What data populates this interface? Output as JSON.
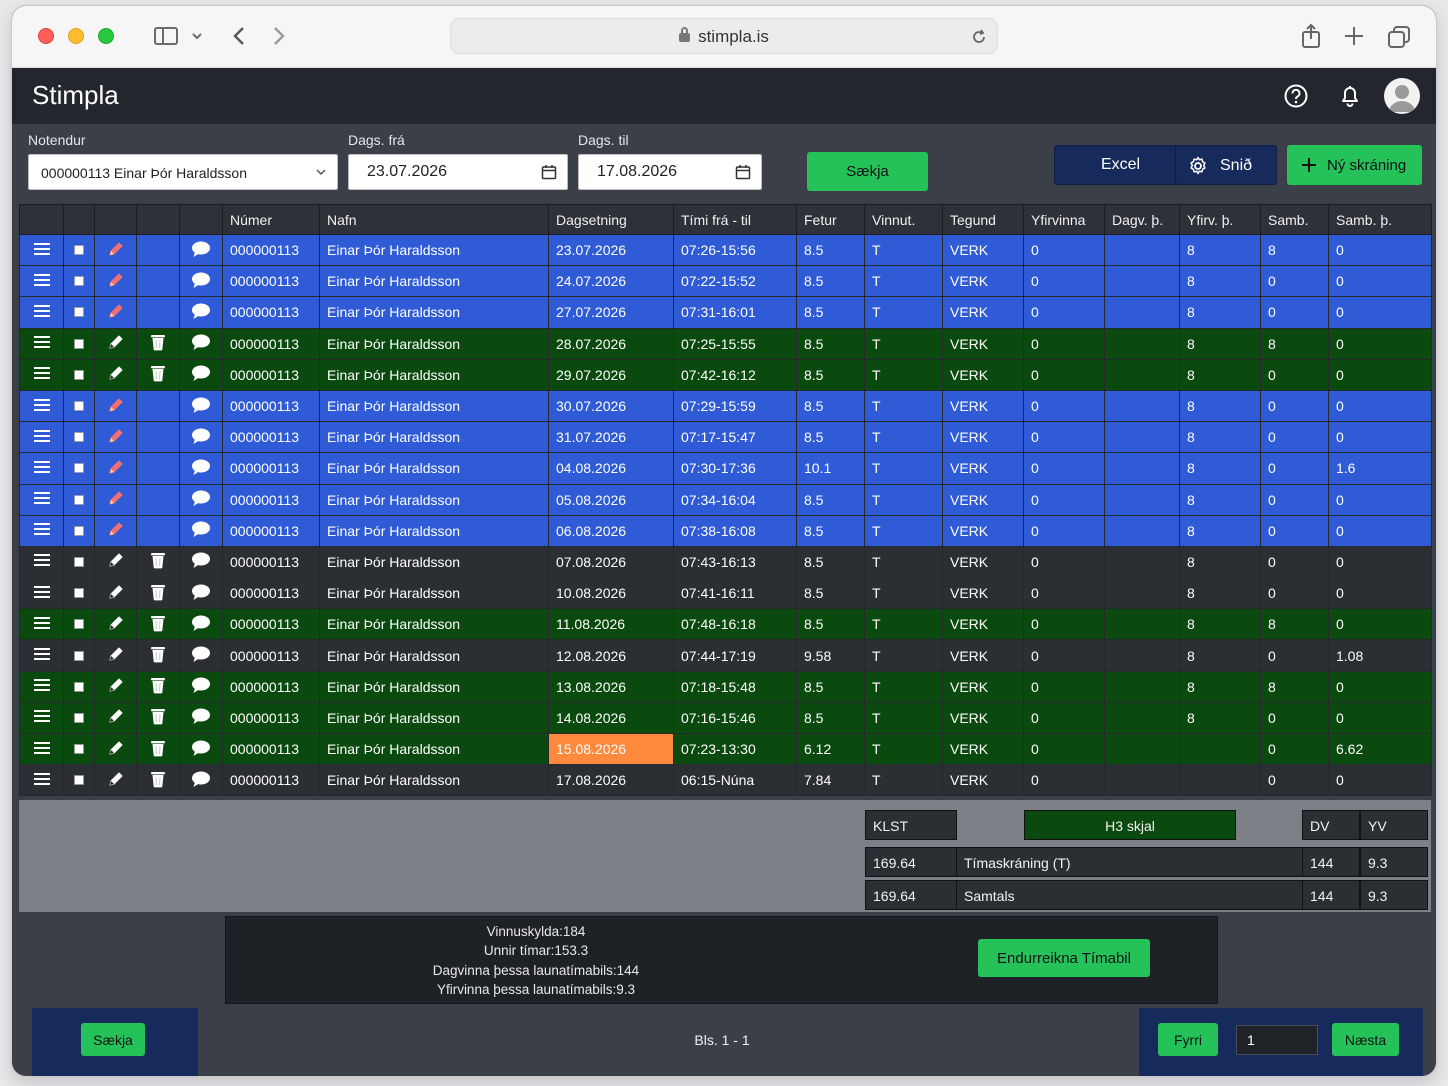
{
  "browser": {
    "url": "stimpla.is"
  },
  "app": {
    "title": "Stimpla"
  },
  "filters": {
    "user_label": "Notendur",
    "user_value": "000000113 Einar Þór Haraldsson",
    "date_from_label": "Dags. frá",
    "date_from": "23.07.2026",
    "date_to_label": "Dags. til",
    "date_to": "17.08.2026",
    "fetch_label": "Sækja",
    "excel_label": "Excel",
    "layout_label": "Snið",
    "new_label": "Ný skráning"
  },
  "table": {
    "columns": [
      "Númer",
      "Nafn",
      "Dagsetning",
      "Tími frá - til",
      "Fetur",
      "Vinnut.",
      "Tegund",
      "Yfirvinna",
      "Dagv. þ.",
      "Yfirv. þ.",
      "Samb.",
      "Samb. þ."
    ],
    "rows": [
      {
        "style": "blue",
        "del": false,
        "num": "000000113",
        "name": "Einar Þór Haraldsson",
        "date": "23.07.2026",
        "time": "07:26-15:56",
        "fetur": "8.5",
        "vinnut": "T",
        "tegund": "VERK",
        "yfirvinna": "0",
        "dagv": "",
        "yfirv": "8",
        "samb": "8",
        "sambth": "0"
      },
      {
        "style": "blue",
        "del": false,
        "num": "000000113",
        "name": "Einar Þór Haraldsson",
        "date": "24.07.2026",
        "time": "07:22-15:52",
        "fetur": "8.5",
        "vinnut": "T",
        "tegund": "VERK",
        "yfirvinna": "0",
        "dagv": "",
        "yfirv": "8",
        "samb": "0",
        "sambth": "0"
      },
      {
        "style": "blue",
        "del": false,
        "num": "000000113",
        "name": "Einar Þór Haraldsson",
        "date": "27.07.2026",
        "time": "07:31-16:01",
        "fetur": "8.5",
        "vinnut": "T",
        "tegund": "VERK",
        "yfirvinna": "0",
        "dagv": "",
        "yfirv": "8",
        "samb": "0",
        "sambth": "0"
      },
      {
        "style": "green",
        "del": true,
        "num": "000000113",
        "name": "Einar Þór Haraldsson",
        "date": "28.07.2026",
        "time": "07:25-15:55",
        "fetur": "8.5",
        "vinnut": "T",
        "tegund": "VERK",
        "yfirvinna": "0",
        "dagv": "",
        "yfirv": "8",
        "samb": "8",
        "sambth": "0"
      },
      {
        "style": "green",
        "del": true,
        "num": "000000113",
        "name": "Einar Þór Haraldsson",
        "date": "29.07.2026",
        "time": "07:42-16:12",
        "fetur": "8.5",
        "vinnut": "T",
        "tegund": "VERK",
        "yfirvinna": "0",
        "dagv": "",
        "yfirv": "8",
        "samb": "0",
        "sambth": "0"
      },
      {
        "style": "blue",
        "del": false,
        "num": "000000113",
        "name": "Einar Þór Haraldsson",
        "date": "30.07.2026",
        "time": "07:29-15:59",
        "fetur": "8.5",
        "vinnut": "T",
        "tegund": "VERK",
        "yfirvinna": "0",
        "dagv": "",
        "yfirv": "8",
        "samb": "0",
        "sambth": "0"
      },
      {
        "style": "blue",
        "del": false,
        "num": "000000113",
        "name": "Einar Þór Haraldsson",
        "date": "31.07.2026",
        "time": "07:17-15:47",
        "fetur": "8.5",
        "vinnut": "T",
        "tegund": "VERK",
        "yfirvinna": "0",
        "dagv": "",
        "yfirv": "8",
        "samb": "0",
        "sambth": "0"
      },
      {
        "style": "blue",
        "del": false,
        "num": "000000113",
        "name": "Einar Þór Haraldsson",
        "date": "04.08.2026",
        "time": "07:30-17:36",
        "fetur": "10.1",
        "vinnut": "T",
        "tegund": "VERK",
        "yfirvinna": "0",
        "dagv": "",
        "yfirv": "8",
        "samb": "0",
        "sambth": "1.6"
      },
      {
        "style": "blue",
        "del": false,
        "num": "000000113",
        "name": "Einar Þór Haraldsson",
        "date": "05.08.2026",
        "time": "07:34-16:04",
        "fetur": "8.5",
        "vinnut": "T",
        "tegund": "VERK",
        "yfirvinna": "0",
        "dagv": "",
        "yfirv": "8",
        "samb": "0",
        "sambth": "0"
      },
      {
        "style": "blue",
        "del": false,
        "num": "000000113",
        "name": "Einar Þór Haraldsson",
        "date": "06.08.2026",
        "time": "07:38-16:08",
        "fetur": "8.5",
        "vinnut": "T",
        "tegund": "VERK",
        "yfirvinna": "0",
        "dagv": "",
        "yfirv": "8",
        "samb": "0",
        "sambth": "0"
      },
      {
        "style": "dark",
        "del": true,
        "num": "000000113",
        "name": "Einar Þór Haraldsson",
        "date": "07.08.2026",
        "time": "07:43-16:13",
        "fetur": "8.5",
        "vinnut": "T",
        "tegund": "VERK",
        "yfirvinna": "0",
        "dagv": "",
        "yfirv": "8",
        "samb": "0",
        "sambth": "0"
      },
      {
        "style": "dark",
        "del": true,
        "num": "000000113",
        "name": "Einar Þór Haraldsson",
        "date": "10.08.2026",
        "time": "07:41-16:11",
        "fetur": "8.5",
        "vinnut": "T",
        "tegund": "VERK",
        "yfirvinna": "0",
        "dagv": "",
        "yfirv": "8",
        "samb": "0",
        "sambth": "0"
      },
      {
        "style": "green",
        "del": true,
        "num": "000000113",
        "name": "Einar Þór Haraldsson",
        "date": "11.08.2026",
        "time": "07:48-16:18",
        "fetur": "8.5",
        "vinnut": "T",
        "tegund": "VERK",
        "yfirvinna": "0",
        "dagv": "",
        "yfirv": "8",
        "samb": "8",
        "sambth": "0"
      },
      {
        "style": "dark",
        "del": true,
        "num": "000000113",
        "name": "Einar Þór Haraldsson",
        "date": "12.08.2026",
        "time": "07:44-17:19",
        "fetur": "9.58",
        "vinnut": "T",
        "tegund": "VERK",
        "yfirvinna": "0",
        "dagv": "",
        "yfirv": "8",
        "samb": "0",
        "sambth": "1.08"
      },
      {
        "style": "green",
        "del": true,
        "num": "000000113",
        "name": "Einar Þór Haraldsson",
        "date": "13.08.2026",
        "time": "07:18-15:48",
        "fetur": "8.5",
        "vinnut": "T",
        "tegund": "VERK",
        "yfirvinna": "0",
        "dagv": "",
        "yfirv": "8",
        "samb": "8",
        "sambth": "0"
      },
      {
        "style": "green",
        "del": true,
        "num": "000000113",
        "name": "Einar Þór Haraldsson",
        "date": "14.08.2026",
        "time": "07:16-15:46",
        "fetur": "8.5",
        "vinnut": "T",
        "tegund": "VERK",
        "yfirvinna": "0",
        "dagv": "",
        "yfirv": "8",
        "samb": "0",
        "sambth": "0"
      },
      {
        "style": "green",
        "del": true,
        "num": "000000113",
        "name": "Einar Þór Haraldsson",
        "date": "15.08.2026",
        "time": "07:23-13:30",
        "fetur": "6.12",
        "vinnut": "T",
        "tegund": "VERK",
        "yfirvinna": "0",
        "dagv": "",
        "yfirv": "",
        "samb": "0",
        "sambth": "6.62",
        "date_highlight": true
      },
      {
        "style": "dark",
        "del": true,
        "num": "000000113",
        "name": "Einar Þór Haraldsson",
        "date": "17.08.2026",
        "time": "06:15-Núna",
        "fetur": "7.84",
        "vinnut": "T",
        "tegund": "VERK",
        "yfirvinna": "0",
        "dagv": "",
        "yfirv": "",
        "samb": "0",
        "sambth": "0"
      }
    ]
  },
  "summary": {
    "klst_label": "KLST",
    "h3_label": "H3 skjal",
    "dv_label": "DV",
    "yv_label": "YV",
    "rows": [
      {
        "klst": "169.64",
        "label": "Tímaskráning (T)",
        "dv": "144",
        "yv": "9.3"
      },
      {
        "klst": "169.64",
        "label": "Samtals",
        "dv": "144",
        "yv": "9.3"
      }
    ]
  },
  "info": {
    "lines": [
      "Vinnuskylda:184",
      "Unnir tímar:153.3",
      "Dagvinna þessa launatímabils:144",
      "Yfirvinna þessa launatímabils:9.3"
    ],
    "recalc_label": "Endurreikna Tímabil"
  },
  "footer": {
    "fetch_label": "Sækja",
    "page_info": "Bls. 1 - 1",
    "prev_label": "Fyrri",
    "page_value": "1",
    "next_label": "Næsta"
  },
  "colors": {
    "blue_row": "#2f5bd6",
    "green_row": "#0b4a0e",
    "dark_row": "#2b2e33",
    "accent_green": "#25c25a",
    "navy": "#172a5c",
    "orange_highlight": "#ff8a3d"
  }
}
